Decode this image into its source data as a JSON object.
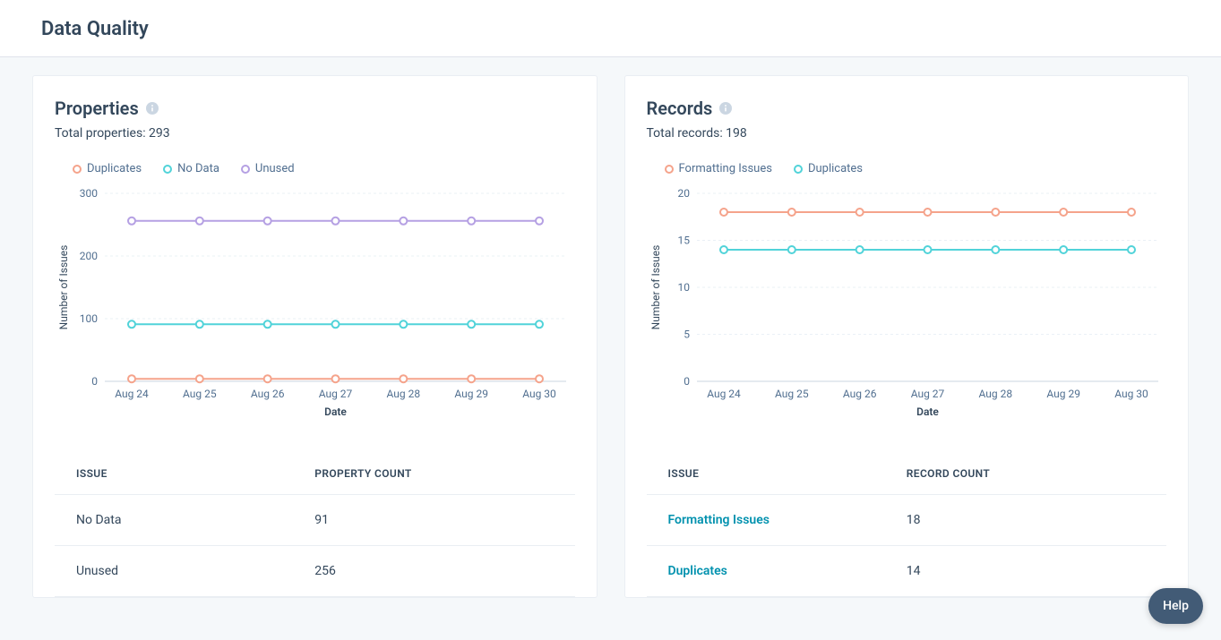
{
  "page_title": "Data Quality",
  "properties": {
    "title": "Properties",
    "subtitle": "Total properties: 293",
    "legend": {
      "duplicates": "Duplicates",
      "no_data": "No Data",
      "unused": "Unused"
    },
    "table": {
      "header_issue": "ISSUE",
      "header_count": "PROPERTY COUNT",
      "rows": [
        {
          "issue": "No Data",
          "count": "91",
          "link": false
        },
        {
          "issue": "Unused",
          "count": "256",
          "link": false
        }
      ]
    }
  },
  "records": {
    "title": "Records",
    "subtitle": "Total records: 198",
    "legend": {
      "formatting": "Formatting Issues",
      "duplicates": "Duplicates"
    },
    "table": {
      "header_issue": "ISSUE",
      "header_count": "RECORD COUNT",
      "rows": [
        {
          "issue": "Formatting Issues",
          "count": "18",
          "link": true
        },
        {
          "issue": "Duplicates",
          "count": "14",
          "link": true
        }
      ]
    }
  },
  "help_label": "Help",
  "chart_meta": {
    "xlabel": "Date",
    "ylabel": "Number of Issues"
  },
  "colors": {
    "orange": "#f5a38b",
    "teal": "#51d3d9",
    "purple": "#b5a0e3",
    "grid": "#eaf0f6",
    "axis_text": "#516f90"
  },
  "chart_data": [
    {
      "id": "properties",
      "type": "line",
      "title": "Properties",
      "xlabel": "Date",
      "ylabel": "Number of Issues",
      "ylim": [
        0,
        300
      ],
      "yticks": [
        0,
        100,
        200,
        300
      ],
      "categories": [
        "Aug 24",
        "Aug 25",
        "Aug 26",
        "Aug 27",
        "Aug 28",
        "Aug 29",
        "Aug 30"
      ],
      "series": [
        {
          "name": "Duplicates",
          "color": "#f5a38b",
          "values": [
            4,
            4,
            4,
            4,
            4,
            4,
            4
          ]
        },
        {
          "name": "No Data",
          "color": "#51d3d9",
          "values": [
            91,
            91,
            91,
            91,
            91,
            91,
            91
          ]
        },
        {
          "name": "Unused",
          "color": "#b5a0e3",
          "values": [
            256,
            256,
            256,
            256,
            256,
            256,
            256
          ]
        }
      ]
    },
    {
      "id": "records",
      "type": "line",
      "title": "Records",
      "xlabel": "Date",
      "ylabel": "Number of Issues",
      "ylim": [
        0,
        20
      ],
      "yticks": [
        0,
        5,
        10,
        15,
        20
      ],
      "categories": [
        "Aug 24",
        "Aug 25",
        "Aug 26",
        "Aug 27",
        "Aug 28",
        "Aug 29",
        "Aug 30"
      ],
      "series": [
        {
          "name": "Formatting Issues",
          "color": "#f5a38b",
          "values": [
            18,
            18,
            18,
            18,
            18,
            18,
            18
          ]
        },
        {
          "name": "Duplicates",
          "color": "#51d3d9",
          "values": [
            14,
            14,
            14,
            14,
            14,
            14,
            14
          ]
        }
      ]
    }
  ]
}
